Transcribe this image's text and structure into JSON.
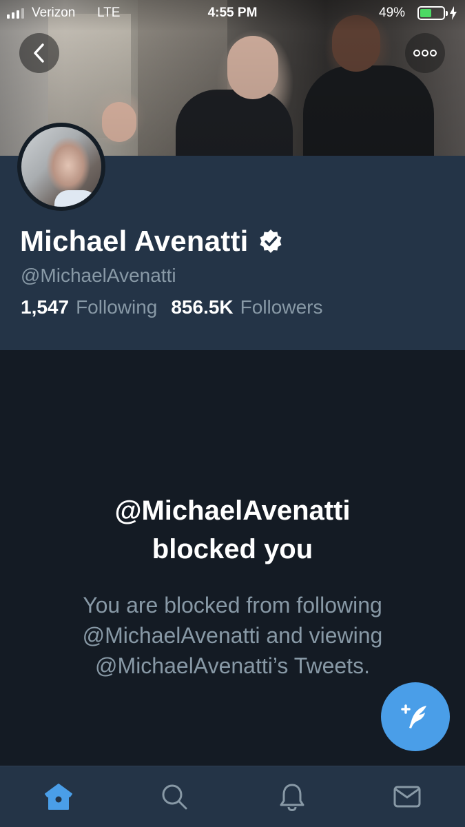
{
  "status_bar": {
    "carrier": "Verizon",
    "network": "LTE",
    "time": "4:55 PM",
    "battery_percent": "49%",
    "battery_level": 0.49,
    "charging": true
  },
  "header": {
    "back_icon": "chevron-left-icon",
    "more_icon": "more-options-icon"
  },
  "profile": {
    "name": "Michael Avenatti",
    "verified": true,
    "handle": "@MichaelAvenatti",
    "following_count": "1,547",
    "following_label": "Following",
    "followers_count": "856.5K",
    "followers_label": "Followers"
  },
  "blocked": {
    "title_line1": "@MichaelAvenatti",
    "title_line2": "blocked you",
    "body_line1": "You are blocked from following",
    "body_line2": "@MichaelAvenatti and viewing",
    "body_line3": "@MichaelAvenatti’s Tweets."
  },
  "tabbar": {
    "items": [
      {
        "icon": "home-icon",
        "active": true
      },
      {
        "icon": "search-icon",
        "active": false
      },
      {
        "icon": "notifications-bell-icon",
        "active": false
      },
      {
        "icon": "messages-envelope-icon",
        "active": false
      }
    ]
  },
  "colors": {
    "accent": "#4a9ee8",
    "background": "#141b24",
    "panel": "#243447",
    "secondary_text": "#8899a6"
  }
}
